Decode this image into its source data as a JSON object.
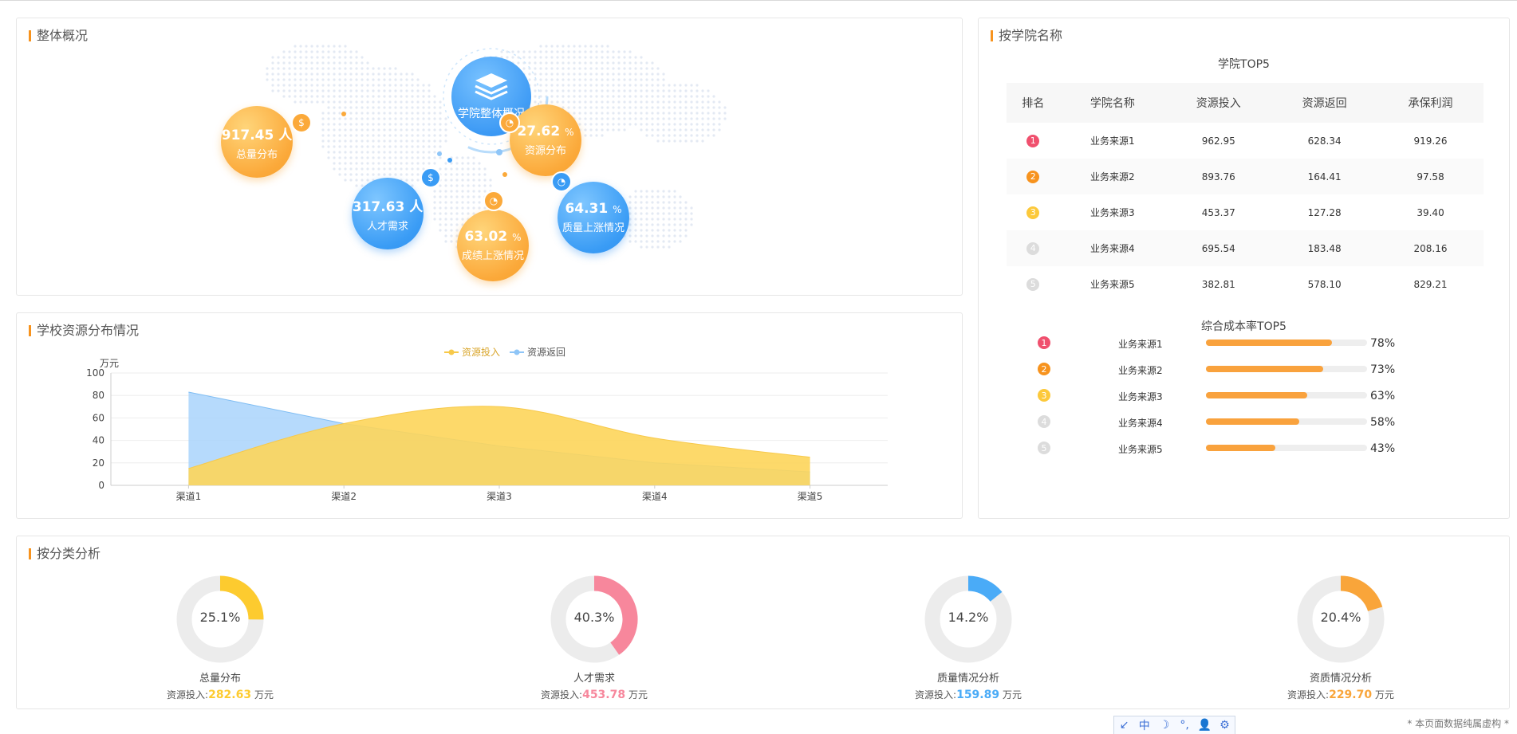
{
  "overview": {
    "title": "整体概况",
    "center_label": "学院整体概况",
    "center_icon": "layers-icon",
    "bubbles": [
      {
        "value": "917.45",
        "unit": "人",
        "label": "总量分布",
        "color": "orange",
        "icon": "money-bag-icon"
      },
      {
        "value": "27.62",
        "unit": "%",
        "label": "资源分布",
        "color": "orange",
        "icon": "pie-icon"
      },
      {
        "value": "317.63",
        "unit": "人",
        "label": "人才需求",
        "color": "blue",
        "icon": "money-bag-icon"
      },
      {
        "value": "63.02",
        "unit": "%",
        "label": "成绩上涨情况",
        "color": "orange",
        "icon": "pie-icon"
      },
      {
        "value": "64.31",
        "unit": "%",
        "label": "质量上涨情况",
        "color": "blue",
        "icon": "pie-icon"
      }
    ]
  },
  "resource": {
    "title": "学校资源分布情况",
    "colors": {
      "invest": "#fdd55a",
      "return": "#a9d3fb"
    }
  },
  "chart_data": {
    "type": "area",
    "categories": [
      "渠道1",
      "渠道2",
      "渠道3",
      "渠道4",
      "渠道5"
    ],
    "series": [
      {
        "name": "资源投入",
        "values": [
          15,
          55,
          70,
          42,
          25
        ]
      },
      {
        "name": "资源返回",
        "values": [
          83,
          55,
          35,
          20,
          12
        ]
      }
    ],
    "ylabel": "万元",
    "ylim": [
      0,
      100
    ],
    "yticks": [
      0,
      20,
      40,
      60,
      80,
      100
    ],
    "legend": "top-center",
    "grid": true
  },
  "college": {
    "title": "按学院名称",
    "top5_title": "学院TOP5",
    "columns": [
      "排名",
      "学院名称",
      "资源投入",
      "资源返回",
      "承保利润"
    ],
    "rows": [
      {
        "rank": "1",
        "name": "业务来源1",
        "invest": "962.95",
        "ret": "628.34",
        "profit": "919.26"
      },
      {
        "rank": "2",
        "name": "业务来源2",
        "invest": "893.76",
        "ret": "164.41",
        "profit": "97.58"
      },
      {
        "rank": "3",
        "name": "业务来源3",
        "invest": "453.37",
        "ret": "127.28",
        "profit": "39.40"
      },
      {
        "rank": "4",
        "name": "业务来源4",
        "invest": "695.54",
        "ret": "183.48",
        "profit": "208.16"
      },
      {
        "rank": "5",
        "name": "业务来源5",
        "invest": "382.81",
        "ret": "578.10",
        "profit": "829.21"
      }
    ],
    "rank_colors": [
      "#f0506e",
      "#f7931e",
      "#fcc93b",
      "#dcdcdc",
      "#dcdcdc"
    ],
    "cost_title": "综合成本率TOP5",
    "cost_rows": [
      {
        "rank": "1",
        "name": "业务来源1",
        "value": 78,
        "pct": "78%"
      },
      {
        "rank": "2",
        "name": "业务来源2",
        "value": 73,
        "pct": "73%"
      },
      {
        "rank": "3",
        "name": "业务来源3",
        "value": 63,
        "pct": "63%"
      },
      {
        "rank": "4",
        "name": "业务来源4",
        "value": 58,
        "pct": "58%"
      },
      {
        "rank": "5",
        "name": "业务来源5",
        "value": 43,
        "pct": "43%"
      }
    ]
  },
  "category": {
    "title": "按分类分析",
    "invest_prefix": "资源投入:",
    "unit": "万元",
    "items": [
      {
        "pct": "25.1%",
        "value": 25.1,
        "name": "总量分布",
        "invest": "282.63",
        "color": "#fdcb2f"
      },
      {
        "pct": "40.3%",
        "value": 40.3,
        "name": "人才需求",
        "invest": "453.78",
        "color": "#f7879c"
      },
      {
        "pct": "14.2%",
        "value": 14.2,
        "name": "质量情况分析",
        "invest": "159.89",
        "color": "#4aabf7"
      },
      {
        "pct": "20.4%",
        "value": 20.4,
        "name": "资质情况分析",
        "invest": "229.70",
        "color": "#f9a53a"
      }
    ]
  },
  "toolbar": {
    "items": [
      "↙",
      "中",
      "☽",
      "°,",
      "👤",
      "⚙"
    ],
    "icons": [
      "expand-icon",
      "chinese-input-icon",
      "moon-icon",
      "punctuation-icon",
      "user-icon",
      "gear-icon"
    ]
  },
  "footnote": "* 本页面数据纯属虚构 *"
}
